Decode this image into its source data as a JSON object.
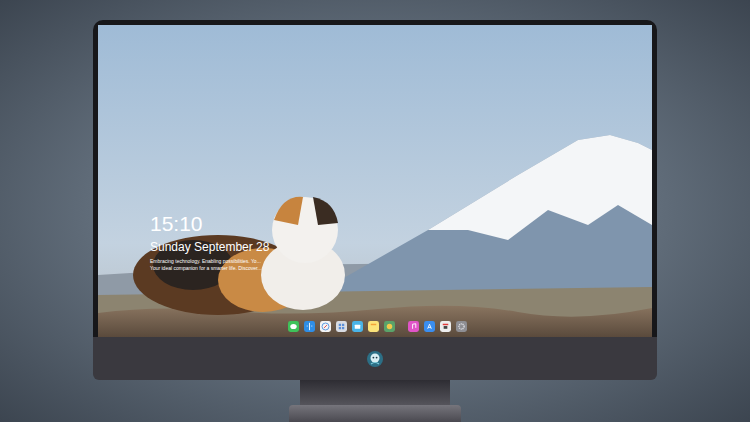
{
  "screen": {
    "clock": "15:10",
    "date": "Sunday September 28",
    "tagline": [
      "Embracing technology. Enabling possibilities. Yo...",
      "Your ideal companion for a smarter life. Discover..."
    ]
  },
  "dock": {
    "icon_count": 11
  }
}
